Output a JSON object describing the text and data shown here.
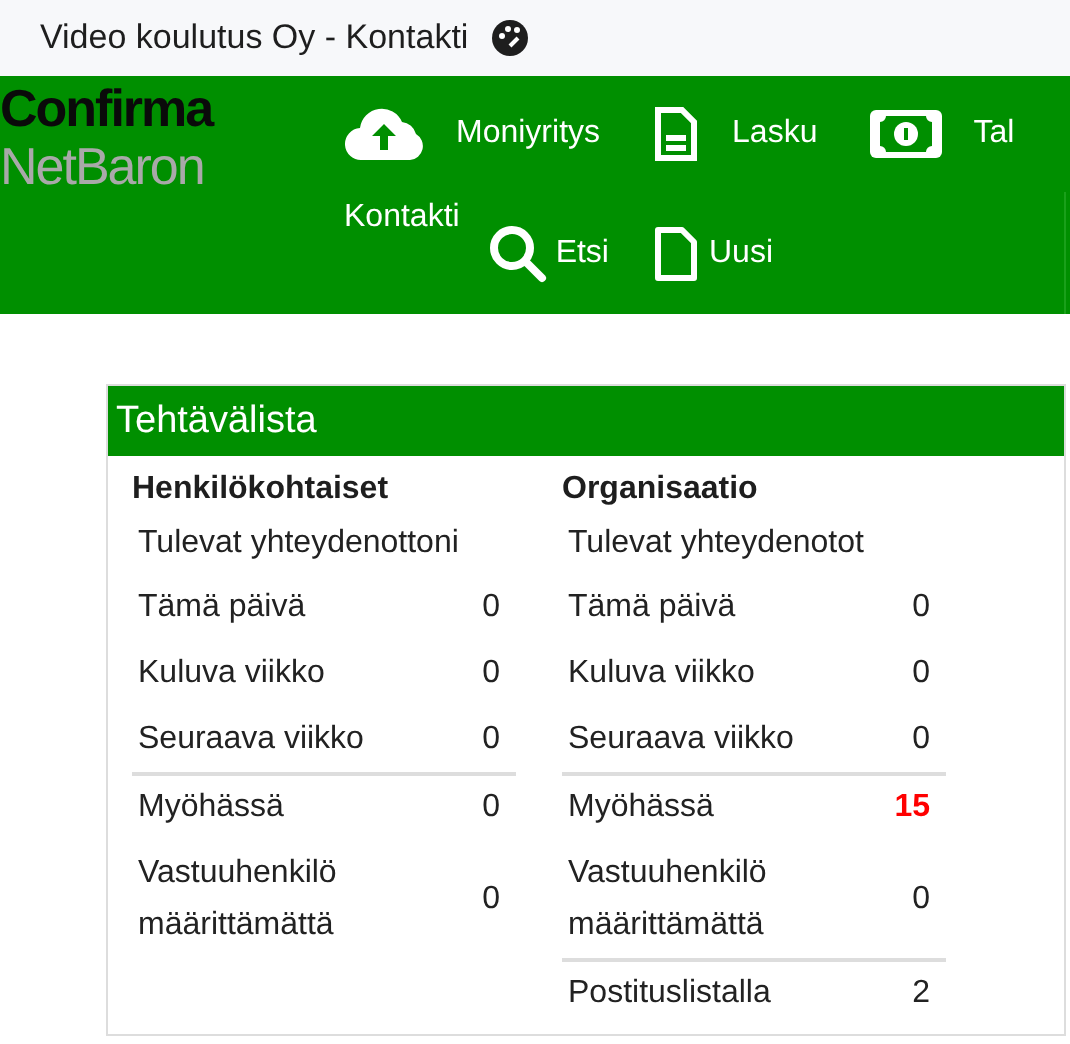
{
  "window": {
    "title": "Video koulutus Oy - Kontakti"
  },
  "logo": {
    "line_1": "Confirma",
    "line_2": "NetBaron"
  },
  "nav": {
    "top_items": [
      {
        "label": "Moniyritys",
        "kind": "upload"
      },
      {
        "label": "Lasku",
        "kind": "invoice"
      },
      {
        "label": "Tal",
        "kind": "money"
      }
    ],
    "bottom_items": [
      {
        "label": "Kontakti",
        "kind": "text"
      },
      {
        "label": "Etsi",
        "kind": "search"
      },
      {
        "label": "Uusi",
        "kind": "new"
      }
    ]
  },
  "panel": {
    "title": "Tehtävälista",
    "columns": [
      {
        "heading": "Henkilökohtaiset",
        "subtitle": "Tulevat yhteydenottoni",
        "rows": [
          {
            "label": "Tämä päivä",
            "value": "0",
            "divider_above": false,
            "alert": false
          },
          {
            "label": "Kuluva viikko",
            "value": "0",
            "divider_above": false,
            "alert": false
          },
          {
            "label": "Seuraava viikko",
            "value": "0",
            "divider_above": false,
            "alert": false
          },
          {
            "label": "Myöhässä",
            "value": "0",
            "divider_above": true,
            "alert": false
          },
          {
            "label": "Vastuuhenkilö määrittämättä",
            "value": "0",
            "divider_above": false,
            "alert": false
          }
        ]
      },
      {
        "heading": "Organisaatio",
        "subtitle": "Tulevat yhteydenotot",
        "rows": [
          {
            "label": "Tämä päivä",
            "value": "0",
            "divider_above": false,
            "alert": false
          },
          {
            "label": "Kuluva viikko",
            "value": "0",
            "divider_above": false,
            "alert": false
          },
          {
            "label": "Seuraava viikko",
            "value": "0",
            "divider_above": false,
            "alert": false
          },
          {
            "label": "Myöhässä",
            "value": "15",
            "divider_above": true,
            "alert": true
          },
          {
            "label": "Vastuuhenkilö määrittämättä",
            "value": "0",
            "divider_above": false,
            "alert": false
          },
          {
            "label": "Postituslistalla",
            "value": "2",
            "divider_above": true,
            "alert": false
          }
        ]
      }
    ]
  }
}
